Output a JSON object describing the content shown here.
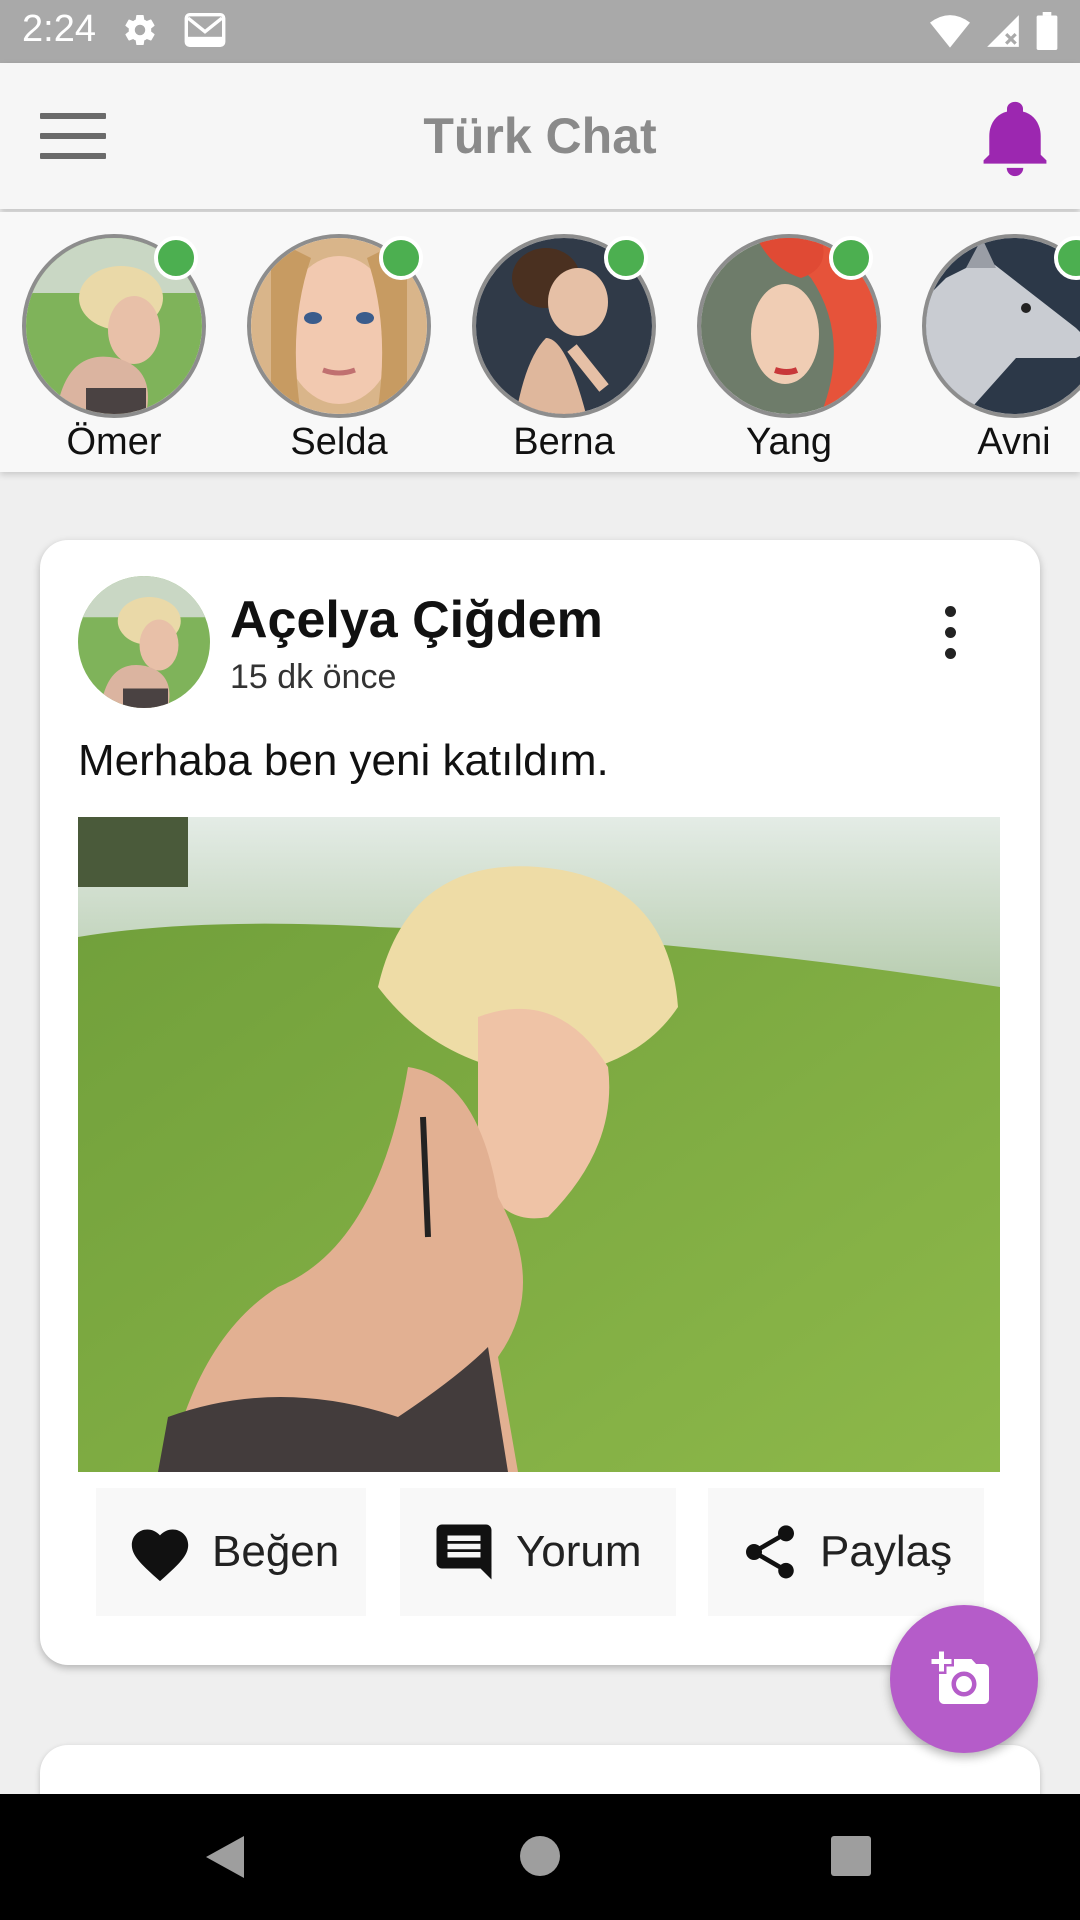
{
  "status_bar": {
    "time": "2:24",
    "icons": [
      "settings-icon",
      "gmail-icon",
      "wifi-icon",
      "signal-icon",
      "battery-icon"
    ]
  },
  "app_bar": {
    "title": "Türk Chat",
    "menu_icon": "hamburger-menu-icon",
    "notification_icon": "bell-icon",
    "accent_color": "#9c27b0"
  },
  "stories": [
    {
      "name": "Ömer",
      "online": true
    },
    {
      "name": "Selda",
      "online": true
    },
    {
      "name": "Berna",
      "online": true
    },
    {
      "name": "Yang",
      "online": true
    },
    {
      "name": "Avni",
      "online": true
    }
  ],
  "post": {
    "author": "Açelya Çiğdem",
    "time": "15 dk önce",
    "text": "Merhaba ben yeni katıldım.",
    "actions": {
      "like": "Beğen",
      "comment": "Yorum",
      "share": "Paylaş"
    }
  },
  "fab": {
    "icon": "add-photo-icon",
    "color": "#b55cc9"
  },
  "online_color": "#4caf50"
}
